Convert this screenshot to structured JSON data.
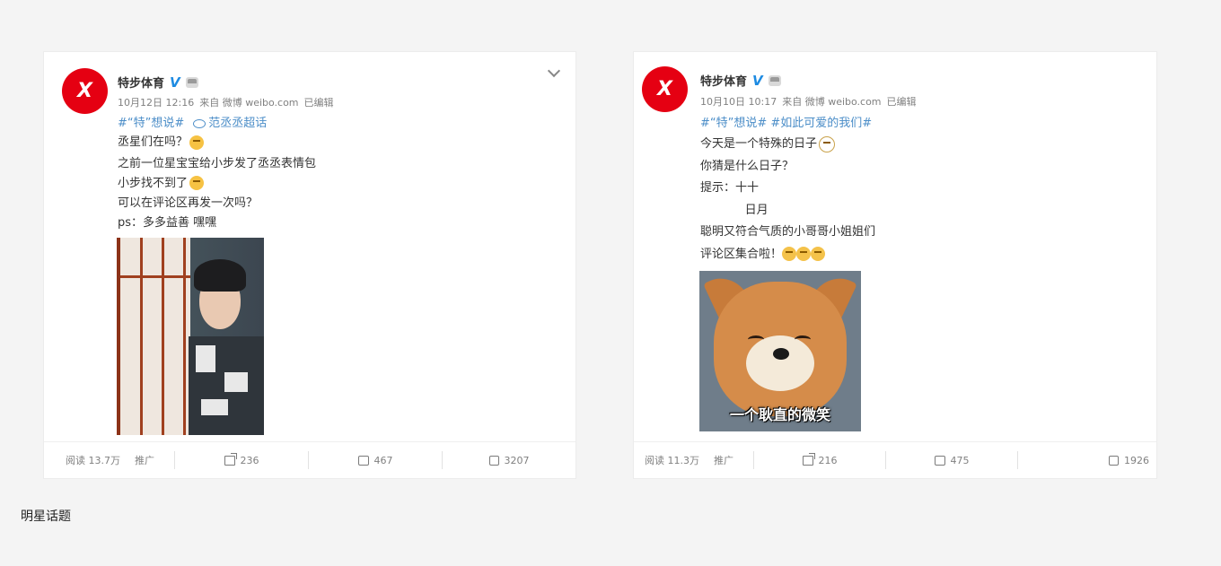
{
  "post1": {
    "account_name": "特步体育",
    "time": "10月12日 12:16",
    "source": "来自 微博 weibo.com",
    "edited": "已编辑",
    "topic1": "#“特”想说#",
    "topic2": "范丞丞超话",
    "lines": [
      "丞星们在吗？",
      "之前一位星宝宝给小步发了丞丞表情包",
      "小步找不到了",
      "可以在评论区再发一次吗？",
      "ps：多多益善 嘿嘿"
    ],
    "read_count": "阅读 13.7万",
    "promote": "推广",
    "shares": "236",
    "comments": "467",
    "likes": "3207"
  },
  "post2": {
    "account_name": "特步体育",
    "time": "10月10日 10:17",
    "source": "来自 微博 weibo.com",
    "edited": "已编辑",
    "topics": "#“特”想说# #如此可爱的我们#",
    "lines": [
      "今天是一个特殊的日子",
      "你猜是什么日子？",
      "提示：十十",
      "            日月",
      "聪明又符合气质的小哥哥小姐姐们",
      "评论区集合啦！"
    ],
    "image_caption": "一个耿直的微笑",
    "read_count": "阅读 11.3万",
    "promote": "推广",
    "shares": "216",
    "comments": "475",
    "likes": "1926"
  },
  "section_label": "明星话题"
}
